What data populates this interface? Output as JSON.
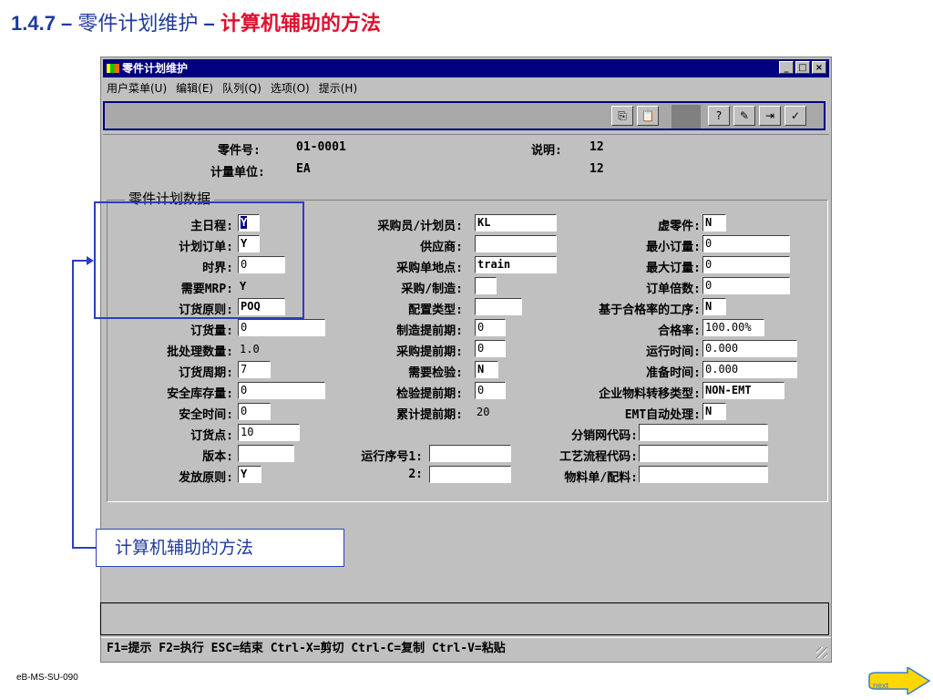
{
  "slide": {
    "title_num": "1.4.7 – ",
    "title_part1": "零件计划维护",
    "title_dash": " – ",
    "title_part2": "计算机辅助的方法",
    "code": "eB-MS-SU-090",
    "callout_text": "计算机辅助的方法",
    "next_label": "next"
  },
  "window": {
    "title": "零件计划维护",
    "btn_min": "_",
    "btn_max": "□",
    "btn_close": "×",
    "menu": [
      "用户菜单(U)",
      "编辑(E)",
      "队列(Q)",
      "选项(O)",
      "提示(H)"
    ],
    "toolbar_icons": [
      "copy-icon",
      "paste-icon",
      "help-pointer-icon",
      "edit-doc-icon",
      "export-doc-icon",
      "check-doc-icon"
    ]
  },
  "header": {
    "part_no_label": "零件号:",
    "part_no_value": "01-0001",
    "desc_label": "说明:",
    "desc_value1": "12",
    "unit_label": "计量单位:",
    "unit_value": "EA",
    "desc_value2": "12"
  },
  "group_title": "零件计划数据",
  "fields": {
    "master_sched_label": "主日程:",
    "master_sched": "Y",
    "plan_order_label": "计划订单:",
    "plan_order": "Y",
    "time_fence_label": "时界:",
    "time_fence": "0",
    "mrp_req_label": "需要MRP:",
    "mrp_req": "Y",
    "order_policy_label": "订货原则:",
    "order_policy": "POQ",
    "order_qty_label": "订货量:",
    "order_qty": "0",
    "batch_qty_label": "批处理数量:",
    "batch_qty": "1.0",
    "order_period_label": "订货周期:",
    "order_period": "7",
    "safety_stock_label": "安全库存量:",
    "safety_stock": "0",
    "safety_time_label": "安全时间:",
    "safety_time": "0",
    "reorder_point_label": "订货点:",
    "reorder_point": "10",
    "revision_label": "版本:",
    "revision": "",
    "issue_policy_label": "发放原则:",
    "issue_policy": "Y",
    "buyer_label": "采购员/计划员:",
    "buyer": "KL",
    "supplier_label": "供应商:",
    "supplier": "",
    "po_site_label": "采购单地点:",
    "po_site": "train",
    "pur_mfg_label": "采购/制造:",
    "pur_mfg": "",
    "config_type_label": "配置类型:",
    "config_type": "",
    "mfg_lead_label": "制造提前期:",
    "mfg_lead": "0",
    "pur_lead_label": "采购提前期:",
    "pur_lead": "0",
    "insp_req_label": "需要检验:",
    "insp_req": "N",
    "insp_lead_label": "检验提前期:",
    "insp_lead": "0",
    "cum_lead_label": "累计提前期:",
    "cum_lead": "20",
    "routing_seq1_label": "运行序号1:",
    "routing_seq1": "",
    "routing_seq2_label": "2:",
    "routing_seq2": "",
    "phantom_label": "虚零件:",
    "phantom": "N",
    "min_order_label": "最小订量:",
    "min_order": "0",
    "max_order_label": "最大订量:",
    "max_order": "0",
    "order_mult_label": "订单倍数:",
    "order_mult": "0",
    "yield_op_label": "基于合格率的工序:",
    "yield_op": "N",
    "yield_label": "合格率:",
    "yield": "100.00%",
    "run_time_label": "运行时间:",
    "run_time": "0.000",
    "setup_time_label": "准备时间:",
    "setup_time": "0.000",
    "emt_type_label": "企业物料转移类型:",
    "emt_type": "NON-EMT",
    "emt_auto_label": "EMT自动处理:",
    "emt_auto": "N",
    "network_label": "分销网代码:",
    "network": "",
    "routing_code_label": "工艺流程代码:",
    "routing_code": "",
    "bom_label": "物料单/配料:",
    "bom": ""
  },
  "helpbar": "F1=提示 F2=执行 ESC=结束 Ctrl-X=剪切 Ctrl-C=复制 Ctrl-V=粘贴"
}
